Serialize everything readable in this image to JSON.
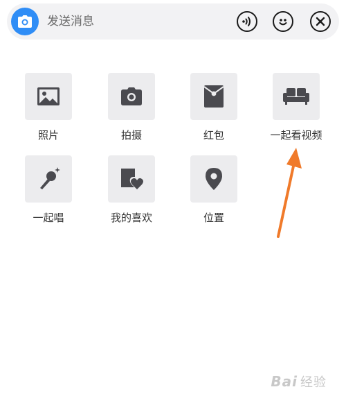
{
  "input_bar": {
    "placeholder": "发送消息",
    "icons": [
      "camera-icon",
      "voice-icon",
      "emoji-icon",
      "close-icon"
    ]
  },
  "actions": [
    {
      "label": "照片",
      "icon": "photo-icon"
    },
    {
      "label": "拍摄",
      "icon": "camera-icon"
    },
    {
      "label": "红包",
      "icon": "red-envelope-icon"
    },
    {
      "label": "一起看视频",
      "icon": "sofa-icon"
    },
    {
      "label": "一起唱",
      "icon": "microphone-icon"
    },
    {
      "label": "我的喜欢",
      "icon": "favorite-icon"
    },
    {
      "label": "位置",
      "icon": "location-pin-icon"
    }
  ],
  "watermark": {
    "brand": "Bai",
    "suffix": "经验"
  },
  "colors": {
    "accent": "#2f8df6",
    "tile_bg": "#ececee",
    "icon": "#4a4a4f",
    "arrow": "#f07a2a"
  }
}
